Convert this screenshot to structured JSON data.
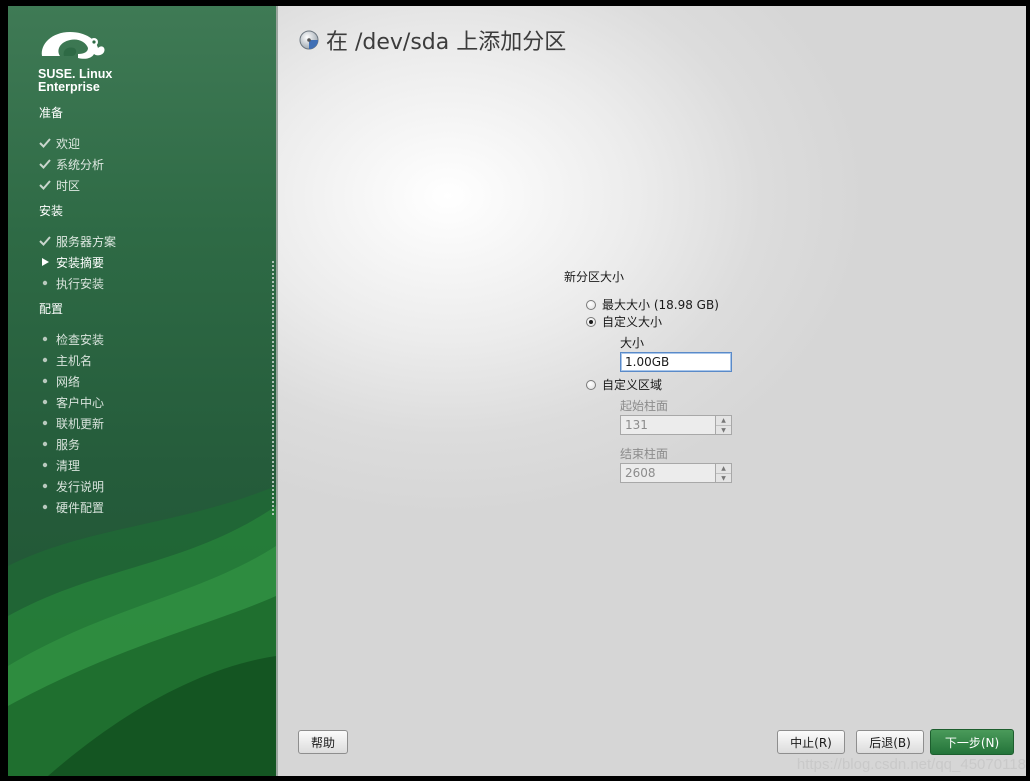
{
  "sidebar": {
    "brand_line1": "SUSE. Linux",
    "brand_line2": "Enterprise",
    "sections": [
      {
        "title": "准备",
        "steps": [
          {
            "label": "欢迎",
            "state": "done"
          },
          {
            "label": "系统分析",
            "state": "done"
          },
          {
            "label": "时区",
            "state": "done"
          }
        ]
      },
      {
        "title": "安装",
        "steps": [
          {
            "label": "服务器方案",
            "state": "done"
          },
          {
            "label": "安装摘要",
            "state": "current"
          },
          {
            "label": "执行安装",
            "state": "pending"
          }
        ]
      },
      {
        "title": "配置",
        "steps": [
          {
            "label": "检查安装",
            "state": "pending"
          },
          {
            "label": "主机名",
            "state": "pending"
          },
          {
            "label": "网络",
            "state": "pending"
          },
          {
            "label": "客户中心",
            "state": "pending"
          },
          {
            "label": "联机更新",
            "state": "pending"
          },
          {
            "label": "服务",
            "state": "pending"
          },
          {
            "label": "清理",
            "state": "pending"
          },
          {
            "label": "发行说明",
            "state": "pending"
          },
          {
            "label": "硬件配置",
            "state": "pending"
          }
        ]
      }
    ]
  },
  "main": {
    "title": "在 /dev/sda 上添加分区",
    "icon": "disk-icon",
    "group_label": "新分区大小",
    "options": {
      "max_size": {
        "label": "最大大小 (18.98 GB)",
        "selected": false
      },
      "custom_size": {
        "label": "自定义大小",
        "selected": true,
        "size_label": "大小",
        "size_value": "1.00GB"
      },
      "custom_region": {
        "label": "自定义区域",
        "selected": false,
        "start_label": "起始柱面",
        "start_value": "131",
        "end_label": "结束柱面",
        "end_value": "2608"
      }
    }
  },
  "buttons": {
    "help": "帮助",
    "abort": "中止(R)",
    "back": "后退(B)",
    "next": "下一步(N)"
  },
  "watermark": "https://blog.csdn.net/qq_45070118",
  "colors": {
    "accent": "#2e7d44",
    "sidebar": "#2e6a45"
  }
}
